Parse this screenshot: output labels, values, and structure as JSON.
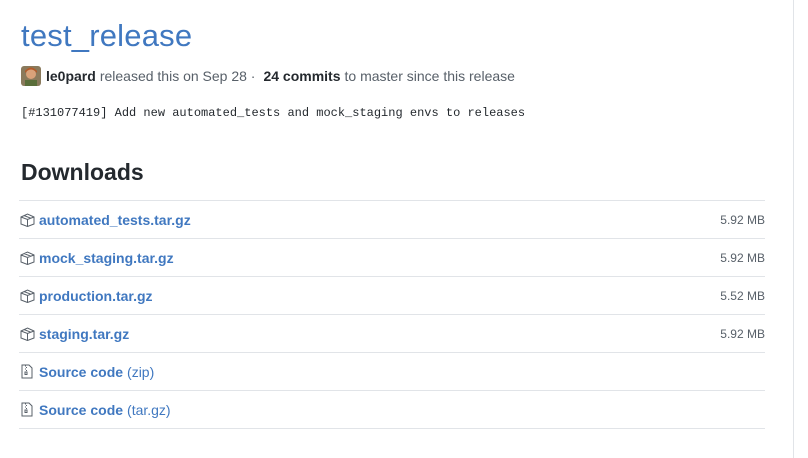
{
  "release": {
    "title": "test_release",
    "author": "le0pard",
    "released_text": "released this on Sep 28 ·",
    "commits_label": "24 commits",
    "commits_suffix": "to master since this release",
    "body": "[#131077419] Add new automated_tests and mock_staging envs to releases"
  },
  "downloads": {
    "heading": "Downloads",
    "assets": [
      {
        "name": "automated_tests.tar.gz",
        "size": "5.92 MB",
        "icon": "package-icon"
      },
      {
        "name": "mock_staging.tar.gz",
        "size": "5.92 MB",
        "icon": "package-icon"
      },
      {
        "name": "production.tar.gz",
        "size": "5.52 MB",
        "icon": "package-icon"
      },
      {
        "name": "staging.tar.gz",
        "size": "5.92 MB",
        "icon": "package-icon"
      }
    ],
    "source": [
      {
        "name": "Source code",
        "format": "(zip)",
        "icon": "file-zip-icon"
      },
      {
        "name": "Source code",
        "format": "(tar.gz)",
        "icon": "file-zip-icon"
      }
    ]
  },
  "colors": {
    "link": "#4078c0",
    "text": "#24292e",
    "muted": "#586069",
    "border": "#e1e4e8"
  }
}
